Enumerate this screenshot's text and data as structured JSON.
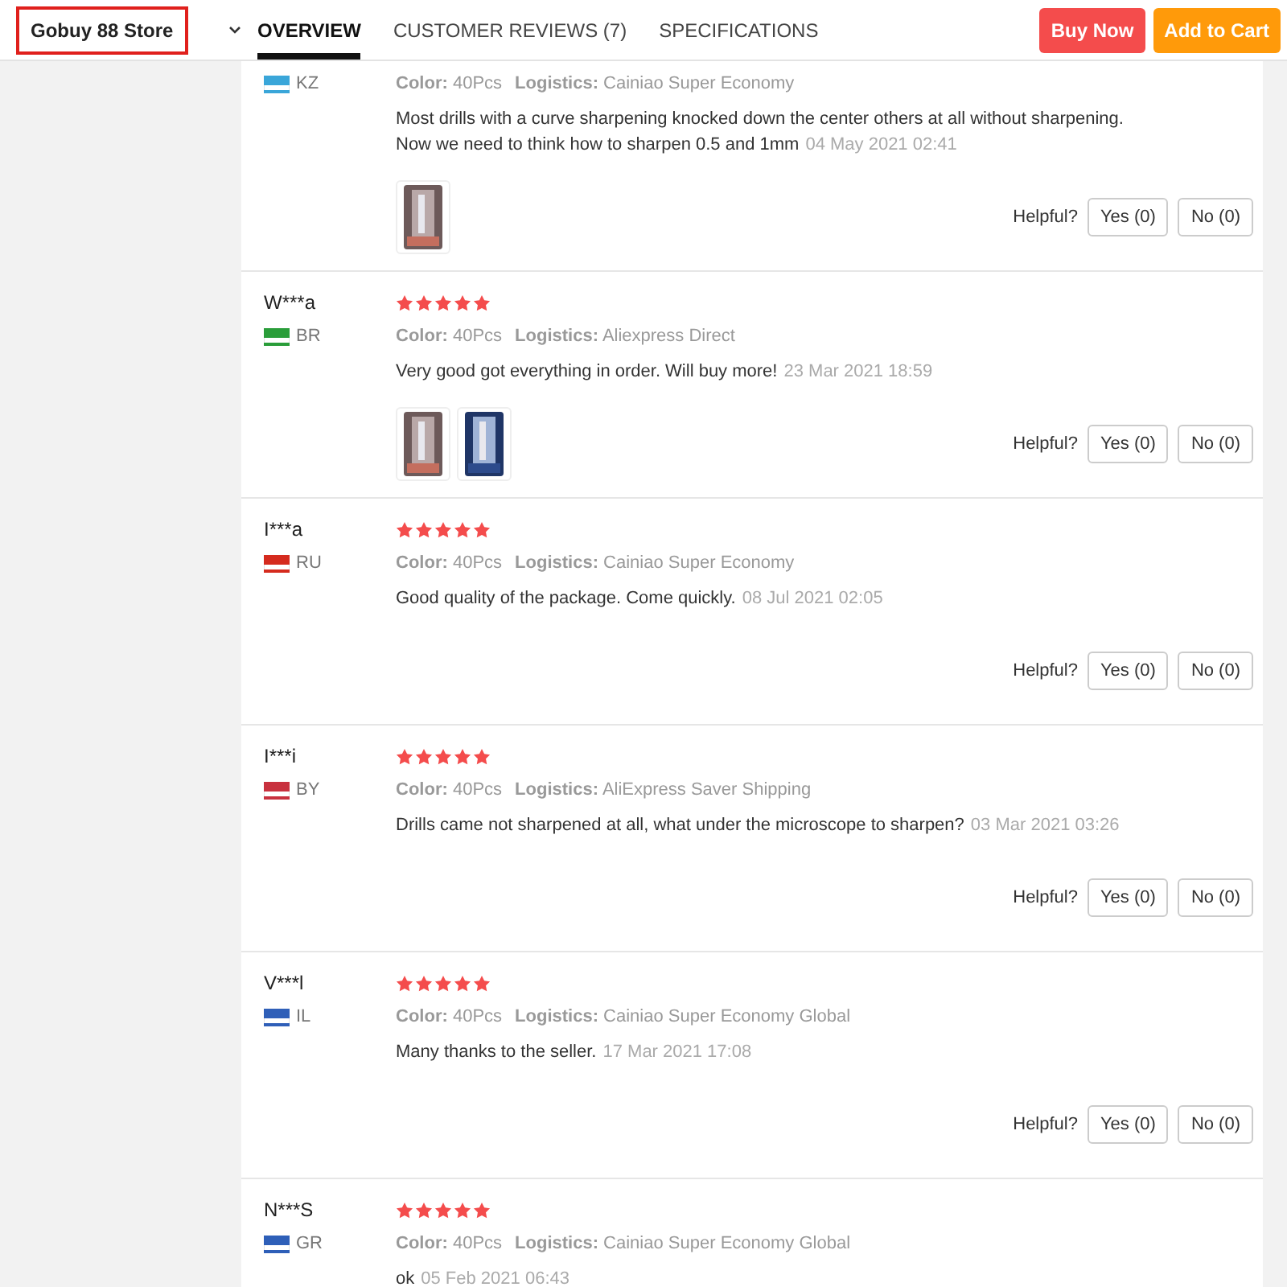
{
  "header": {
    "store_select": {
      "value": "Gobuy 88 Store"
    },
    "tabs": [
      {
        "label": "OVERVIEW",
        "selected": true
      },
      {
        "label": "CUSTOMER REVIEWS (7)",
        "selected": false
      },
      {
        "label": "SPECIFICATIONS",
        "selected": false
      }
    ],
    "buttons": [
      {
        "label": "Buy Now",
        "kind": "primary"
      },
      {
        "label": "Add to Cart",
        "kind": "secondary"
      }
    ]
  },
  "reviews": [
    {
      "country": "KZ",
      "color": "#3aa6d9",
      "color_label": "Color:",
      "color_value": "40Pcs",
      "logistics_label": "Logistics:",
      "logistics_value": "Cainiao Super Economy",
      "text": "Most drills with a curve sharpening knocked down the center others at all without sharpening. Now we need to think how to sharpen 0.5 and 1mm",
      "date": "04 May 2021 02:41",
      "photos": [
        {
          "kind": "picture"
        }
      ],
      "helpful": "Helpful?",
      "yes": "Yes (0)",
      "no": "No (0)"
    },
    {
      "name": "W***a",
      "stars": 5,
      "country": "BR",
      "color": "#2a9d3a",
      "color_label": "Color:",
      "color_value": "40Pcs",
      "logistics_label": "Logistics:",
      "logistics_value": "Aliexpress Direct",
      "text": "Very good got everything in order. Will buy more!",
      "date": "23 Mar 2021 18:59",
      "photos": [
        {
          "kind": "picture"
        },
        {
          "kind": "picture"
        }
      ],
      "helpful": "Helpful?",
      "yes": "Yes (0)",
      "no": "No (0)"
    },
    {
      "name": "I***a",
      "stars": 5,
      "country": "RU",
      "color": "#d52b1e",
      "color_label": "Color:",
      "color_value": "40Pcs",
      "logistics_label": "Logistics:",
      "logistics_value": "Cainiao Super Economy",
      "text": "Good quality of the package. Come quickly.",
      "date": "08 Jul 2021 02:05",
      "helpful": "Helpful?",
      "yes": "Yes (0)",
      "no": "No (0)"
    },
    {
      "name": "I***i",
      "stars": 5,
      "country": "BY",
      "color": "#c8313e",
      "color_label": "Color:",
      "color_value": "40Pcs",
      "logistics_label": "Logistics:",
      "logistics_value": "AliExpress Saver Shipping",
      "text": "Drills came not sharpened at all, what under the microscope to sharpen?",
      "date": "03 Mar 2021 03:26",
      "helpful": "Helpful?",
      "yes": "Yes (0)",
      "no": "No (0)"
    },
    {
      "name": "V***l",
      "stars": 5,
      "country": "IL",
      "color": "#2f5fb8",
      "color_label": "Color:",
      "color_value": "40Pcs",
      "logistics_label": "Logistics:",
      "logistics_value": "Cainiao Super Economy Global",
      "text": "Many thanks to the seller.",
      "date": "17 Mar 2021 17:08",
      "helpful": "Helpful?",
      "yes": "Yes (0)",
      "no": "No (0)"
    },
    {
      "name": "N***S",
      "stars": 5,
      "country": "GR",
      "color": "#2e5fb8",
      "color_label": "Color:",
      "color_value": "40Pcs",
      "logistics_label": "Logistics:",
      "logistics_value": "Cainiao Super Economy Global",
      "text": "ok",
      "date": "05 Feb 2021 06:43"
    }
  ]
}
